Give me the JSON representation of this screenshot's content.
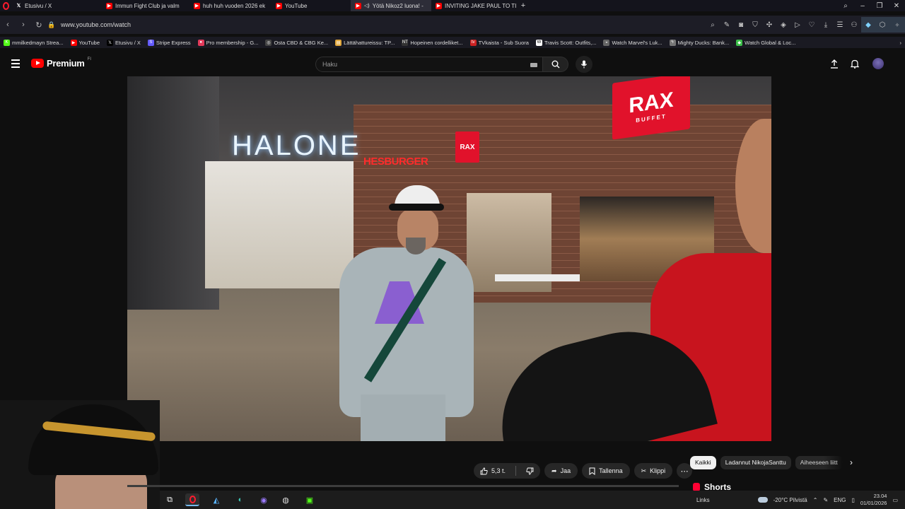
{
  "browser": {
    "tabs": [
      {
        "label": "Etusivu / X",
        "favicon": "x-icon"
      },
      {
        "label": "Immun Fight Club ja valm",
        "favicon": "youtube-icon"
      },
      {
        "label": "huh huh vuoden 2026 ek",
        "favicon": "youtube-icon"
      },
      {
        "label": "YouTube",
        "favicon": "youtube-icon"
      },
      {
        "label": "Yötä Nikoz2 luona! -",
        "favicon": "youtube-icon",
        "active": true
      },
      {
        "label": "INVITING JAKE PAUL TO TI",
        "favicon": "youtube-icon"
      }
    ],
    "new_tab": "+",
    "url": "www.youtube.com/watch",
    "bookmarks": [
      {
        "label": "mmilkedmayn Strea...",
        "favicon": "kick-icon",
        "color": "#53fc18"
      },
      {
        "label": "YouTube",
        "favicon": "youtube-icon",
        "color": "#ff0000"
      },
      {
        "label": "Etusivu / X",
        "favicon": "x-icon",
        "color": "#000000"
      },
      {
        "label": "Stripe Express",
        "favicon": "stripe-icon",
        "color": "#635bff"
      },
      {
        "label": "Pro membership - G...",
        "favicon": "pin-icon",
        "color": "#e23a5a"
      },
      {
        "label": "Osta CBD & CBG Ke...",
        "favicon": "leaf-icon",
        "color": "#444444"
      },
      {
        "label": "Lättähattureissu: TP...",
        "favicon": "doc-icon",
        "color": "#e0a63a"
      },
      {
        "label": "Hopeinen cordelliket...",
        "favicon": "nt-icon",
        "color": "#333333"
      },
      {
        "label": "TVkaista - Sub Suora",
        "favicon": "tv-icon",
        "color": "#cc2222"
      },
      {
        "label": "Travis Scott: Outfits,...",
        "favicon": "w-icon",
        "color": "#ffffff"
      },
      {
        "label": "Watch Marvel's Luk...",
        "favicon": "mask-icon",
        "color": "#666666"
      },
      {
        "label": "Mighty Ducks: Bank...",
        "favicon": "bolt-icon",
        "color": "#777777"
      },
      {
        "label": "Watch Global & Loc...",
        "favicon": "game-icon",
        "color": "#3dbf4a"
      }
    ]
  },
  "youtube": {
    "logo_text": "Premium",
    "logo_country": "FI",
    "search_placeholder": "Haku"
  },
  "video": {
    "sign_halonen": "HALONE",
    "sign_rax": "RAX",
    "sign_rax_sub": "BUFFET",
    "sign_hesburger": "HESBURGER"
  },
  "actions": {
    "likes": "5,3 t.",
    "share": "Jaa",
    "save": "Tallenna",
    "clip": "Klippi",
    "more": "⋯"
  },
  "chips": [
    {
      "label": "Kaikki",
      "active": true
    },
    {
      "label": "Ladannut NikojaSanttu",
      "active": false
    },
    {
      "label": "Aiheeseen liitt",
      "active": false
    }
  ],
  "shorts_label": "Shorts",
  "taskbar": {
    "links_label": "Links",
    "weather": "-20°C Pilvistä",
    "lang": "ENG",
    "time": "23.04",
    "date": "01/01/2026"
  }
}
